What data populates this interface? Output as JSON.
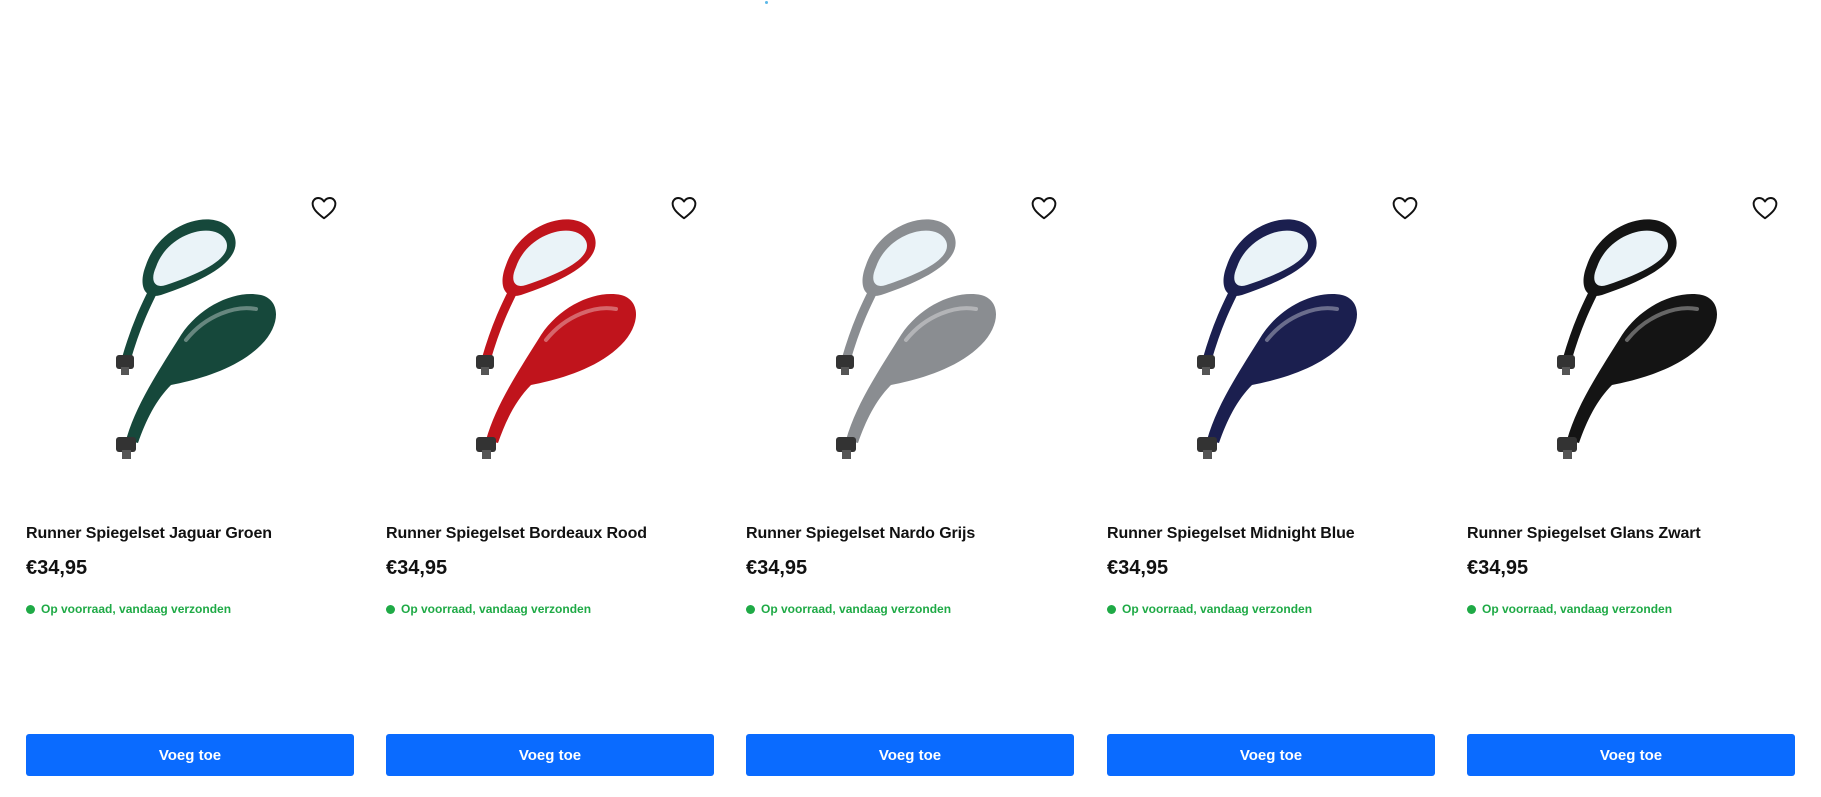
{
  "products": [
    {
      "name": "Runner Spiegelset Jaguar Groen",
      "price": "€34,95",
      "stock": "Op voorraad, vandaag verzonden",
      "button": "Voeg toe",
      "color": "#16483b",
      "image_icon": "mirror-set-image",
      "wishlist_icon": "heart-icon"
    },
    {
      "name": "Runner Spiegelset Bordeaux Rood",
      "price": "€34,95",
      "stock": "Op voorraad, vandaag verzonden",
      "button": "Voeg toe",
      "color": "#c0141c",
      "image_icon": "mirror-set-image",
      "wishlist_icon": "heart-icon"
    },
    {
      "name": "Runner Spiegelset Nardo Grijs",
      "price": "€34,95",
      "stock": "Op voorraad, vandaag verzonden",
      "button": "Voeg toe",
      "color": "#8a8d91",
      "image_icon": "mirror-set-image",
      "wishlist_icon": "heart-icon"
    },
    {
      "name": "Runner Spiegelset Midnight Blue",
      "price": "€34,95",
      "stock": "Op voorraad, vandaag verzonden",
      "button": "Voeg toe",
      "color": "#1b1f4f",
      "image_icon": "mirror-set-image",
      "wishlist_icon": "heart-icon"
    },
    {
      "name": "Runner Spiegelset Glans Zwart",
      "price": "€34,95",
      "stock": "Op voorraad, vandaag verzonden",
      "button": "Voeg toe",
      "color": "#141414",
      "image_icon": "mirror-set-image",
      "wishlist_icon": "heart-icon"
    }
  ],
  "colors": {
    "accent": "#0a6bff",
    "stock_green": "#1faa46"
  }
}
